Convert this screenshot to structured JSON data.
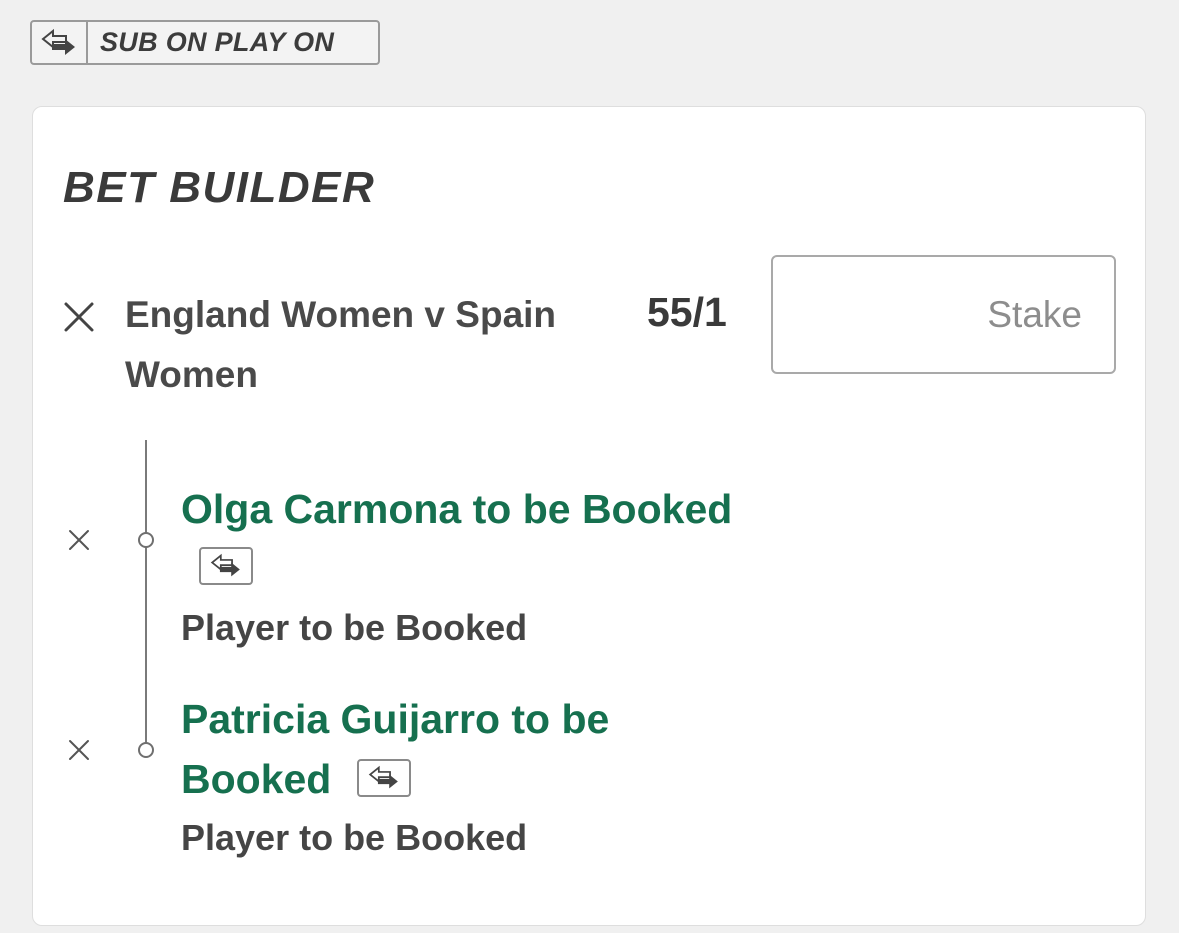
{
  "sub_badge": {
    "icon": "sub-swap-icon",
    "label": "SUB ON PLAY ON"
  },
  "bet_builder": {
    "title": "BET BUILDER",
    "event": {
      "name": "England Women v Spain Women",
      "odds": "55/1",
      "stake_placeholder": "Stake",
      "stake_value": ""
    },
    "selections": [
      {
        "name": "Olga Carmona to be Booked",
        "market": "Player to be Booked",
        "icon": "sub-swap-icon"
      },
      {
        "name": "Patricia Guijarro to be Booked",
        "market": "Player to be Booked",
        "icon": "sub-swap-icon"
      }
    ]
  },
  "colors": {
    "selection_green": "#16704f",
    "background": "#f0f0f0",
    "card": "#ffffff"
  }
}
